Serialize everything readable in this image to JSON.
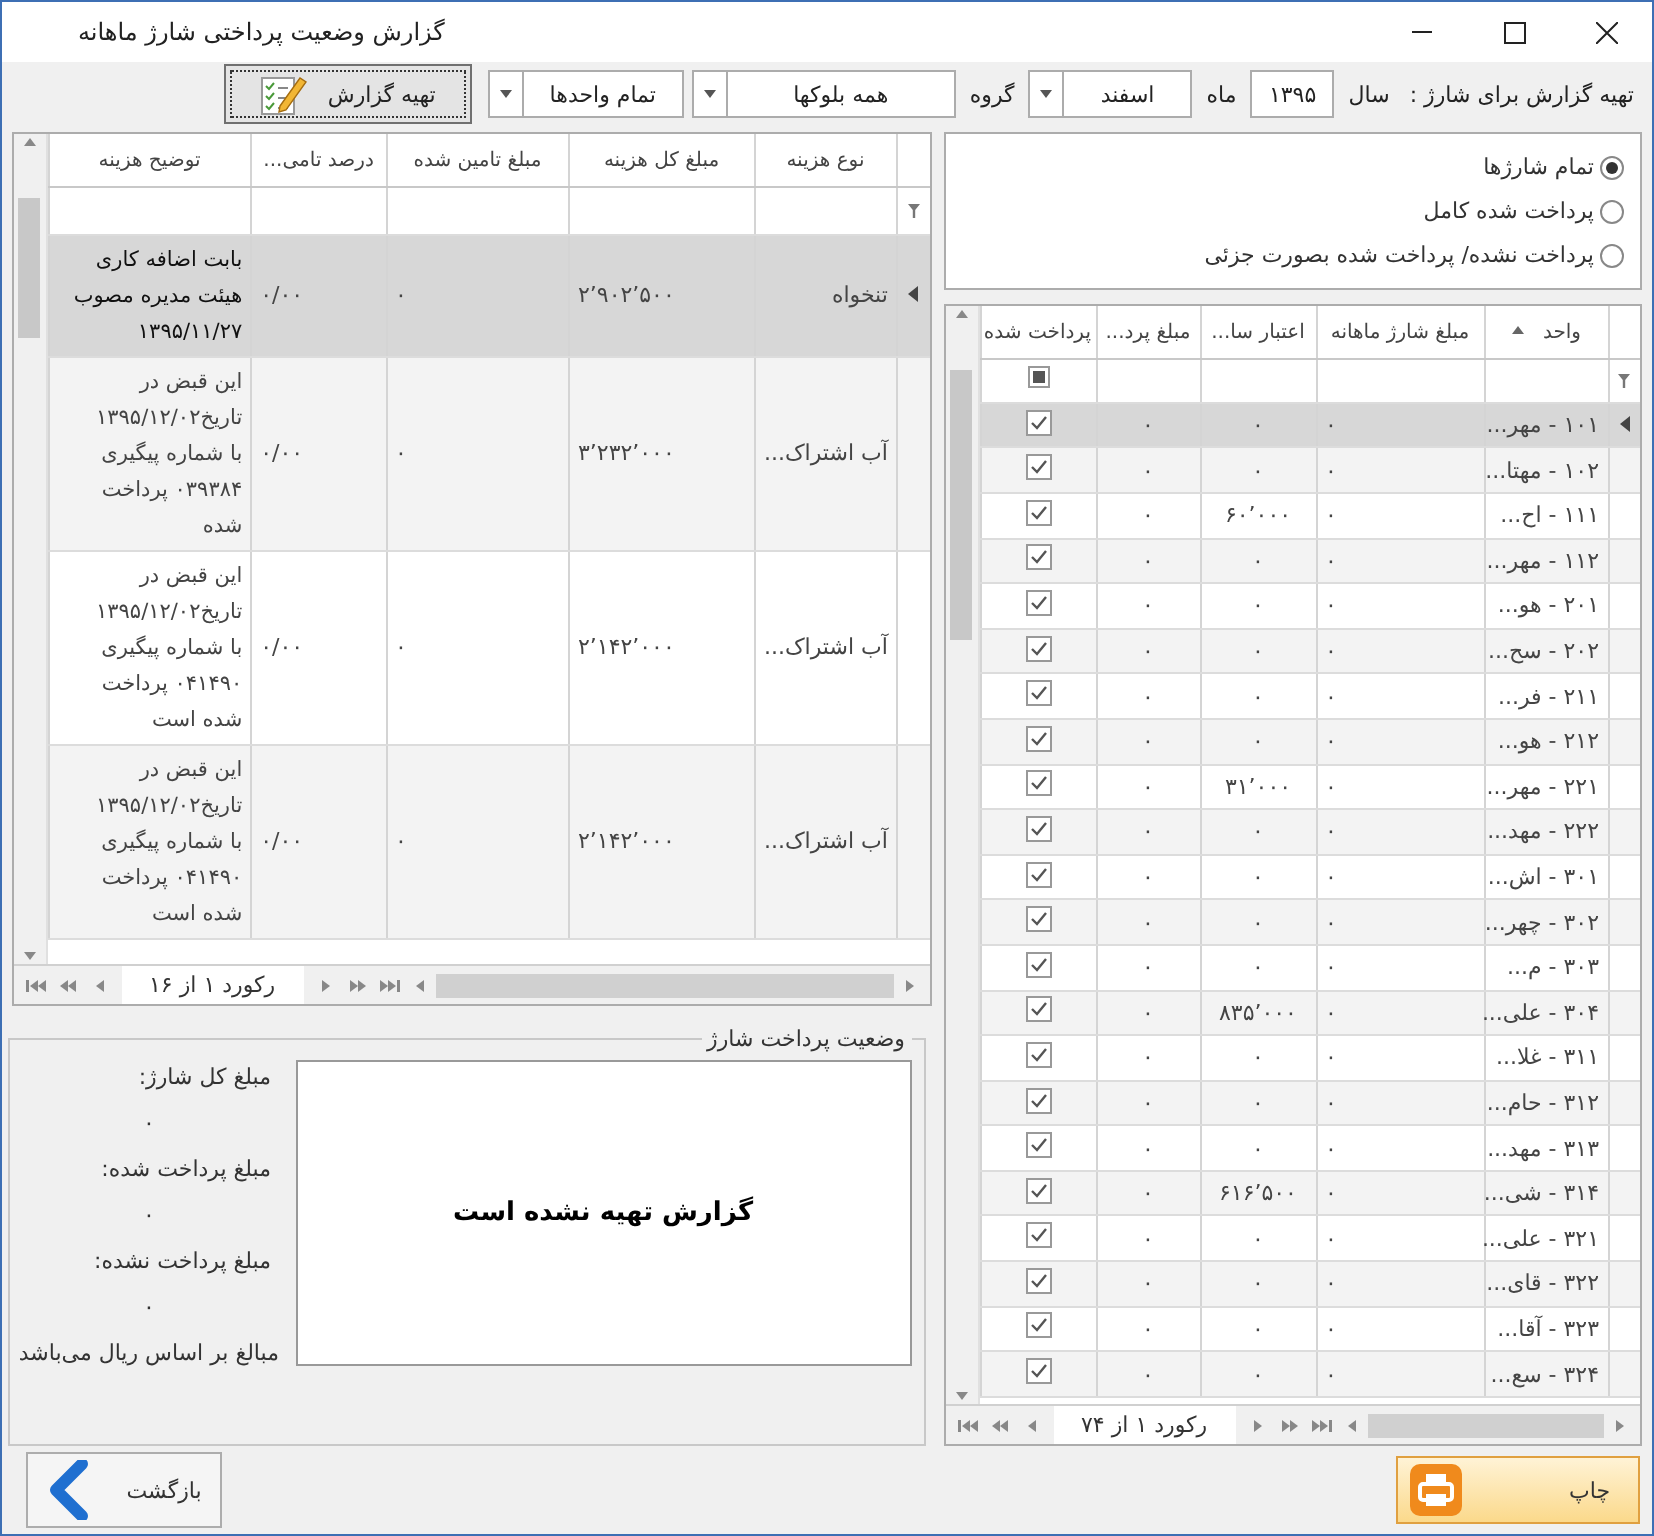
{
  "window": {
    "title": "گزارش وضعیت پرداختی شارژ ماهانه"
  },
  "toolbar": {
    "prompt": "تهیه گزارش برای شارژ :",
    "year_label": "سال",
    "year": "۱۳۹۵",
    "month_label": "ماه",
    "month": "اسفند",
    "group_label": "گروه",
    "group": "همه بلوکها",
    "units": "تمام واحدها",
    "report_button": "تهیه گزارش"
  },
  "filter_options": [
    {
      "label": "تمام شارژها",
      "selected": true
    },
    {
      "label": "پرداخت شده کامل",
      "selected": false
    },
    {
      "label": "پرداخت نشده/ پرداخت شده بصورت جزئی",
      "selected": false
    }
  ],
  "units_grid": {
    "columns": [
      {
        "label": "واحد",
        "sorted": true
      },
      {
        "label": "مبلغ شارژ ماهانه",
        "sorted": false
      },
      {
        "label": "اعتبار سا...",
        "sorted": false
      },
      {
        "label": "مبلغ پرد...",
        "sorted": false
      },
      {
        "label": "پرداخت شده",
        "sorted": false
      }
    ],
    "paid_filter_indeterminate": true,
    "rows": [
      {
        "unit": "۱۰۱ - مهر...",
        "monthly_charge": "۰",
        "credit": "۰",
        "paid_amount": "۰",
        "paid": true,
        "selected": true
      },
      {
        "unit": "۱۰۲ - مهتا...",
        "monthly_charge": "۰",
        "credit": "۰",
        "paid_amount": "۰",
        "paid": true,
        "selected": false
      },
      {
        "unit": "۱۱۱ - اح...",
        "monthly_charge": "۰",
        "credit": "۶۰٬۰۰۰",
        "paid_amount": "۰",
        "paid": true,
        "selected": false
      },
      {
        "unit": "۱۱۲ - مهر...",
        "monthly_charge": "۰",
        "credit": "۰",
        "paid_amount": "۰",
        "paid": true,
        "selected": false
      },
      {
        "unit": "۲۰۱ - هو...",
        "monthly_charge": "۰",
        "credit": "۰",
        "paid_amount": "۰",
        "paid": true,
        "selected": false
      },
      {
        "unit": "۲۰۲ - سح...",
        "monthly_charge": "۰",
        "credit": "۰",
        "paid_amount": "۰",
        "paid": true,
        "selected": false
      },
      {
        "unit": "۲۱۱ - فر...",
        "monthly_charge": "۰",
        "credit": "۰",
        "paid_amount": "۰",
        "paid": true,
        "selected": false
      },
      {
        "unit": "۲۱۲ - هو...",
        "monthly_charge": "۰",
        "credit": "۰",
        "paid_amount": "۰",
        "paid": true,
        "selected": false
      },
      {
        "unit": "۲۲۱ - مهر...",
        "monthly_charge": "۰",
        "credit": "۳۱٬۰۰۰",
        "paid_amount": "۰",
        "paid": true,
        "selected": false
      },
      {
        "unit": "۲۲۲ - مهد...",
        "monthly_charge": "۰",
        "credit": "۰",
        "paid_amount": "۰",
        "paid": true,
        "selected": false
      },
      {
        "unit": "۳۰۱ - اش...",
        "monthly_charge": "۰",
        "credit": "۰",
        "paid_amount": "۰",
        "paid": true,
        "selected": false
      },
      {
        "unit": "۳۰۲ - چهر...",
        "monthly_charge": "۰",
        "credit": "۰",
        "paid_amount": "۰",
        "paid": true,
        "selected": false
      },
      {
        "unit": "۳۰۳ - م...",
        "monthly_charge": "۰",
        "credit": "۰",
        "paid_amount": "۰",
        "paid": true,
        "selected": false
      },
      {
        "unit": "۳۰۴ - علی...",
        "monthly_charge": "۰",
        "credit": "۸۳۵٬۰۰۰",
        "paid_amount": "۰",
        "paid": true,
        "selected": false
      },
      {
        "unit": "۳۱۱ - غلا...",
        "monthly_charge": "۰",
        "credit": "۰",
        "paid_amount": "۰",
        "paid": true,
        "selected": false
      },
      {
        "unit": "۳۱۲ - حام...",
        "monthly_charge": "۰",
        "credit": "۰",
        "paid_amount": "۰",
        "paid": true,
        "selected": false
      },
      {
        "unit": "۳۱۳ - مهد...",
        "monthly_charge": "۰",
        "credit": "۰",
        "paid_amount": "۰",
        "paid": true,
        "selected": false
      },
      {
        "unit": "۳۱۴ - شی...",
        "monthly_charge": "۰",
        "credit": "۶۱۶٬۵۰۰",
        "paid_amount": "۰",
        "paid": true,
        "selected": false
      },
      {
        "unit": "۳۲۱ - علی...",
        "monthly_charge": "۰",
        "credit": "۰",
        "paid_amount": "۰",
        "paid": true,
        "selected": false
      },
      {
        "unit": "۳۲۲ - قای...",
        "monthly_charge": "۰",
        "credit": "۰",
        "paid_amount": "۰",
        "paid": true,
        "selected": false
      },
      {
        "unit": "۳۲۳ - آقا...",
        "monthly_charge": "۰",
        "credit": "۰",
        "paid_amount": "۰",
        "paid": true,
        "selected": false
      },
      {
        "unit": "۳۲۴ - سع...",
        "monthly_charge": "۰",
        "credit": "۰",
        "paid_amount": "۰",
        "paid": true,
        "selected": false
      }
    ],
    "navigator": "رکورد ۱ از ۷۴"
  },
  "expenses_grid": {
    "columns": [
      "نوع هزینه",
      "مبلغ کل هزینه",
      "مبلغ تامین شده",
      "درصد تامی...",
      "توضیح هزینه"
    ],
    "rows": [
      {
        "type": "تنخواه",
        "total": "۲٬۹۰۲٬۵۰۰",
        "funded": "۰",
        "percent": "۰/۰۰",
        "description": "بابت اضافه کاری\nهیئت مدیره مصوب\n۱۳۹۵/۱۱/۲۷",
        "selected": true
      },
      {
        "type": "آب اشتراک...",
        "total": "۳٬۲۳۲٬۰۰۰",
        "funded": "۰",
        "percent": "۰/۰۰",
        "description": "این قبض در\nتاریخ۱۳۹۵/۱۲/۰۲\nبا شماره پیگیری\n۰۳۹۳۸۴ پرداخت\nشده",
        "selected": false
      },
      {
        "type": "آب اشتراک...",
        "total": "۲٬۱۴۲٬۰۰۰",
        "funded": "۰",
        "percent": "۰/۰۰",
        "description": "این قبض در\nتاریخ۱۳۹۵/۱۲/۰۲\nبا شماره پیگیری\n۰۴۱۴۹۰ پرداخت\nشده است",
        "selected": false
      },
      {
        "type": "آب اشتراک...",
        "total": "۲٬۱۴۲٬۰۰۰",
        "funded": "۰",
        "percent": "۰/۰۰",
        "description": "این قبض در\nتاریخ۱۳۹۵/۱۲/۰۲\nبا شماره پیگیری\n۰۴۱۴۹۰ پرداخت\nشده است",
        "selected": false
      }
    ],
    "navigator": "رکورد ۱ از ۱۶"
  },
  "payment_status": {
    "legend": "وضعیت پرداخت شارژ",
    "report_message": "گزارش تهیه نشده است",
    "amounts": [
      {
        "label": "مبلغ کل شارژ:",
        "value": "۰"
      },
      {
        "label": "مبلغ پرداخت شده:",
        "value": "۰"
      },
      {
        "label": "مبلغ پرداخت نشده:",
        "value": "۰"
      }
    ],
    "note": "مبالغ بر اساس ریال می‌باشد"
  },
  "buttons": {
    "back": "بازگشت",
    "print": "چاپ"
  }
}
